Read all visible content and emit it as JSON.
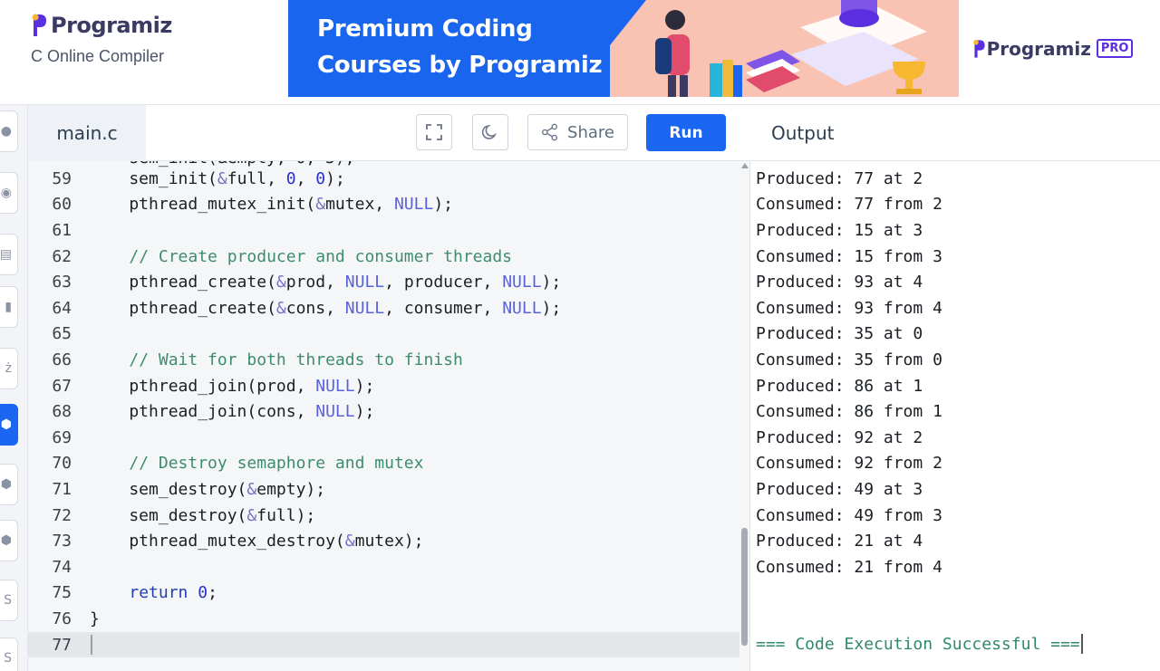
{
  "brand": {
    "name": "Programiz",
    "subtitle": "C Online Compiler"
  },
  "banner": {
    "line1": "Premium Coding",
    "line2": "Courses by Programiz",
    "pro_logo": "Programiz",
    "pro_badge": "PRO"
  },
  "editor": {
    "file_tab": "main.c",
    "share_label": "Share",
    "run_label": "Run",
    "lines": [
      {
        "num": "59",
        "code": "    sem_init(&full, 0, 0);"
      },
      {
        "num": "60",
        "code": "    pthread_mutex_init(&mutex, NULL);"
      },
      {
        "num": "61",
        "code": ""
      },
      {
        "num": "62",
        "code": "    // Create producer and consumer threads"
      },
      {
        "num": "63",
        "code": "    pthread_create(&prod, NULL, producer, NULL);"
      },
      {
        "num": "64",
        "code": "    pthread_create(&cons, NULL, consumer, NULL);"
      },
      {
        "num": "65",
        "code": ""
      },
      {
        "num": "66",
        "code": "    // Wait for both threads to finish"
      },
      {
        "num": "67",
        "code": "    pthread_join(prod, NULL);"
      },
      {
        "num": "68",
        "code": "    pthread_join(cons, NULL);"
      },
      {
        "num": "69",
        "code": ""
      },
      {
        "num": "70",
        "code": "    // Destroy semaphore and mutex"
      },
      {
        "num": "71",
        "code": "    sem_destroy(&empty);"
      },
      {
        "num": "72",
        "code": "    sem_destroy(&full);"
      },
      {
        "num": "73",
        "code": "    pthread_mutex_destroy(&mutex);"
      },
      {
        "num": "74",
        "code": ""
      },
      {
        "num": "75",
        "code": "    return 0;"
      },
      {
        "num": "76",
        "code": "}"
      },
      {
        "num": "77",
        "code": ""
      }
    ],
    "current_line": "77"
  },
  "output": {
    "title": "Output",
    "lines": [
      "Produced: 77 at 2",
      "Consumed: 77 from 2",
      "Produced: 15 at 3",
      "Consumed: 15 from 3",
      "Produced: 93 at 4",
      "Consumed: 93 from 4",
      "Produced: 35 at 0",
      "Consumed: 35 from 0",
      "Produced: 86 at 1",
      "Consumed: 86 from 1",
      "Produced: 92 at 2",
      "Consumed: 92 from 2",
      "Produced: 49 at 3",
      "Consumed: 49 from 3",
      "Produced: 21 at 4",
      "Consumed: 21 from 4"
    ],
    "status": "=== Code Execution Successful ==="
  },
  "colors": {
    "accent": "#1a66f0",
    "brand_purple": "#5b2ee0",
    "comment": "#3e8c6f",
    "success": "#2f8a6b"
  },
  "rail": {
    "icons": [
      "python-icon",
      "r-icon",
      "sql-icon",
      "html-icon",
      "java-icon",
      "c-icon",
      "cpp-icon",
      "csharp-icon",
      "js-icon",
      "swift-icon"
    ],
    "active_icon": "c-icon"
  }
}
